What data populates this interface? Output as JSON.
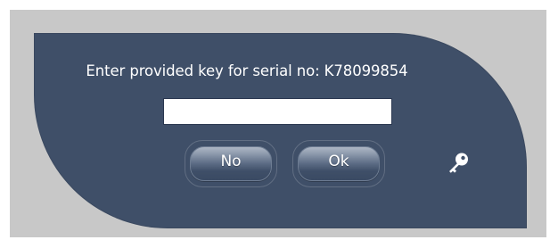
{
  "dialog": {
    "prompt": "Enter provided key for serial no: K78099854",
    "key_input": {
      "value": "",
      "placeholder": ""
    },
    "buttons": {
      "no_label": "No",
      "ok_label": "Ok"
    },
    "icon": "key-icon"
  },
  "colors": {
    "backdrop": "#c8c8c8",
    "dialog_background": "#3f4f68",
    "text": "#ffffff"
  }
}
